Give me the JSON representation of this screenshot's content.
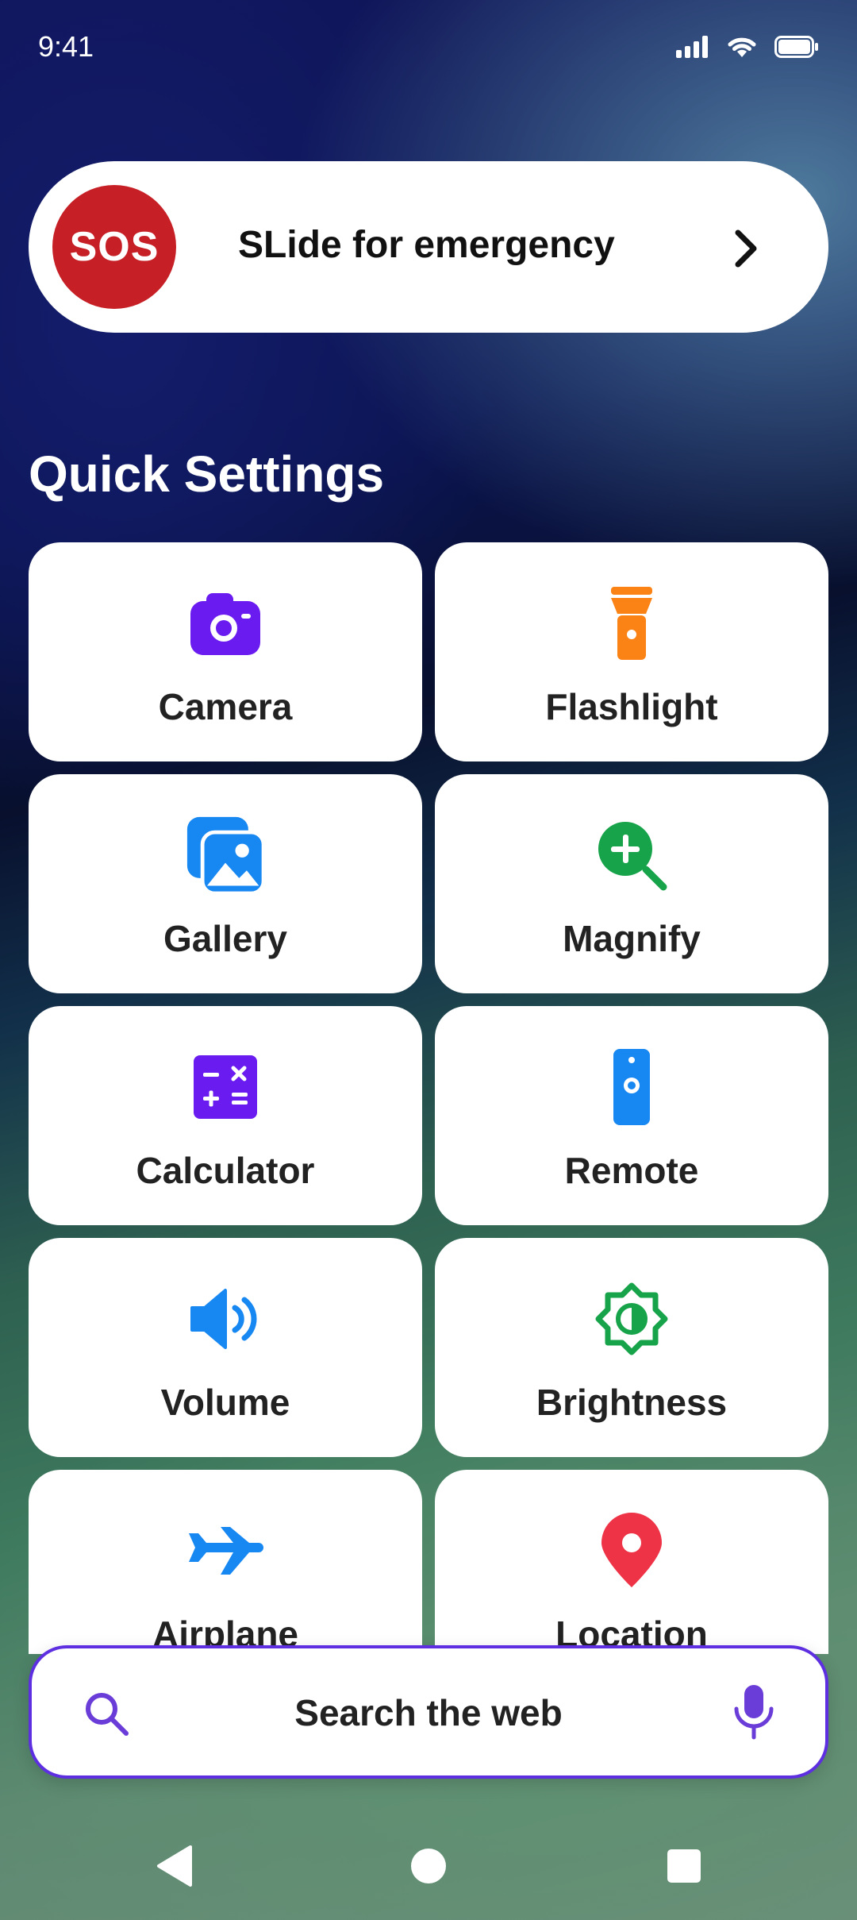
{
  "status_bar": {
    "time": "9:41"
  },
  "sos": {
    "badge": "SOS",
    "label": "SLide for emergency",
    "badge_color": "#c62026"
  },
  "section_title": "Quick Settings",
  "tiles": [
    {
      "label": "Camera",
      "icon": "camera-icon",
      "color": "#6a1cf0"
    },
    {
      "label": "Flashlight",
      "icon": "flashlight-icon",
      "color": "#fb8214"
    },
    {
      "label": "Gallery",
      "icon": "gallery-icon",
      "color": "#1787f2"
    },
    {
      "label": "Magnify",
      "icon": "magnify-icon",
      "color": "#17a34a"
    },
    {
      "label": "Calculator",
      "icon": "calculator-icon",
      "color": "#6a1cf0"
    },
    {
      "label": "Remote",
      "icon": "remote-icon",
      "color": "#1787f2"
    },
    {
      "label": "Volume",
      "icon": "volume-icon",
      "color": "#1787f2"
    },
    {
      "label": "Brightness",
      "icon": "brightness-icon",
      "color": "#17a34a"
    },
    {
      "label": "Airplane",
      "icon": "airplane-icon",
      "color": "#1787f2"
    },
    {
      "label": "Location",
      "icon": "location-icon",
      "color": "#ef3347"
    }
  ],
  "search": {
    "placeholder": "Search the web",
    "accent": "#5d2fe0"
  },
  "nav": {
    "back": "back-icon",
    "home": "home-icon",
    "recents": "recents-icon"
  }
}
